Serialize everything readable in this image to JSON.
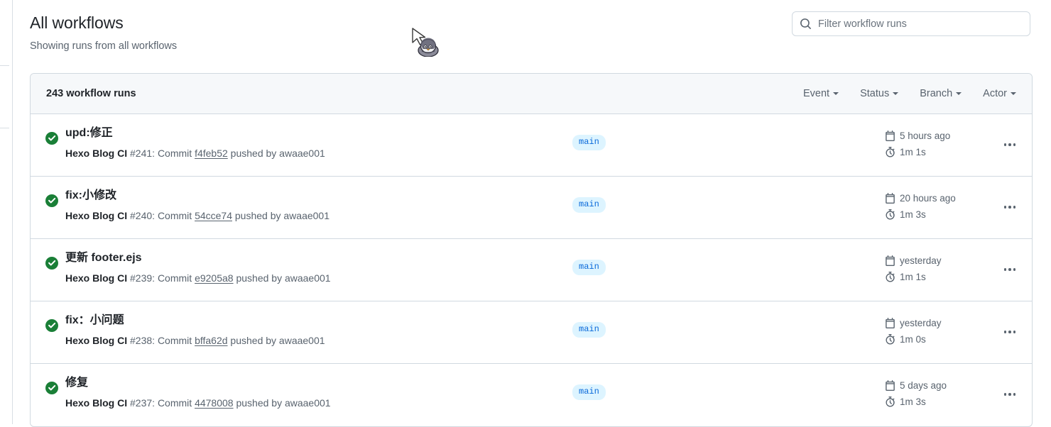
{
  "header": {
    "title": "All workflows",
    "subtitle": "Showing runs from all workflows"
  },
  "search": {
    "placeholder": "Filter workflow runs",
    "value": "",
    "icon": "search-icon"
  },
  "toolbar": {
    "runs_count_label": "243 workflow runs",
    "filters": [
      {
        "label": "Event"
      },
      {
        "label": "Status"
      },
      {
        "label": "Branch"
      },
      {
        "label": "Actor"
      }
    ]
  },
  "colors": {
    "success": "#1a7f37",
    "branch_badge_bg": "#ddf4ff",
    "branch_badge_text": "#0969da",
    "border": "#d1d9e0",
    "header_bg": "#f6f8fa",
    "muted_text": "#59636e"
  },
  "runs": [
    {
      "status": "success",
      "title": "upd:修正",
      "workflow": "Hexo Blog CI",
      "meta_middle": " #241: Commit ",
      "sha": "f4feb52",
      "meta_tail": " pushed by awaae001",
      "branch": "main",
      "age": "5 hours ago",
      "duration": "1m 1s"
    },
    {
      "status": "success",
      "title": "fix:小修改",
      "workflow": "Hexo Blog CI",
      "meta_middle": " #240: Commit ",
      "sha": "54cce74",
      "meta_tail": " pushed by awaae001",
      "branch": "main",
      "age": "20 hours ago",
      "duration": "1m 3s"
    },
    {
      "status": "success",
      "title": "更新 footer.ejs",
      "workflow": "Hexo Blog CI",
      "meta_middle": " #239: Commit ",
      "sha": "e9205a8",
      "meta_tail": " pushed by awaae001",
      "branch": "main",
      "age": "yesterday",
      "duration": "1m 1s"
    },
    {
      "status": "success",
      "title": "fix：小问题",
      "workflow": "Hexo Blog CI",
      "meta_middle": " #238: Commit ",
      "sha": "bffa62d",
      "meta_tail": " pushed by awaae001",
      "branch": "main",
      "age": "yesterday",
      "duration": "1m 0s"
    },
    {
      "status": "success",
      "title": "修复",
      "workflow": "Hexo Blog CI",
      "meta_middle": " #237: Commit ",
      "sha": "4478008",
      "meta_tail": " pushed by awaae001",
      "branch": "main",
      "age": "5 days ago",
      "duration": "1m 3s"
    }
  ],
  "icons": {
    "status_success": "check-circle-icon",
    "age": "calendar-icon",
    "duration": "stopwatch-icon",
    "row_menu": "kebab-menu-icon",
    "cursor": "arrow-cursor-with-penguin"
  }
}
